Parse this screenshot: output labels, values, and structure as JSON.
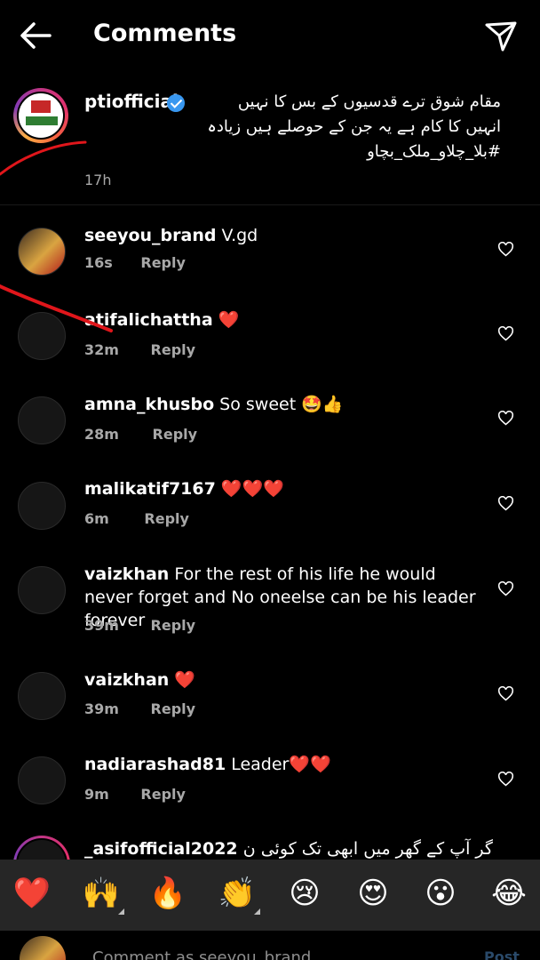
{
  "header": {
    "title": "Comments"
  },
  "caption": {
    "username": "ptiofficial",
    "lines": [
      "مقام شوق ترے قدسیوں کے بس کا نہیں",
      "انہیں کا کام ہے یہ جن کے حوصلے ہیں زیادہ",
      "#بلا_چلاو_ملک_بچاو"
    ],
    "time": "17h"
  },
  "comments": [
    {
      "username": "seeyou_brand",
      "text": "V.gd",
      "time": "16s",
      "reply": "Reply"
    },
    {
      "username": "atifalichattha",
      "text": "❤️",
      "time": "32m",
      "reply": "Reply"
    },
    {
      "username": "amna_khusbo",
      "text": "So sweet 🤩👍",
      "time": "28m",
      "reply": "Reply"
    },
    {
      "username": "malikatif7167",
      "text": "❤️❤️❤️",
      "time": "6m",
      "reply": "Reply"
    },
    {
      "username": "vaizkhan",
      "text": "For the rest of his life he would never forget and No oneelse can be his leader forever",
      "time": "39m",
      "reply": "Reply"
    },
    {
      "username": "vaizkhan",
      "text": "❤️",
      "time": "39m",
      "reply": "Reply"
    },
    {
      "username": "nadiarashad81",
      "text": "Leader❤️❤️",
      "time": "9m",
      "reply": "Reply"
    },
    {
      "username": "_asifofficial2022",
      "text": "اگر آپ کے گھر میں ابھی تک کوئی ن"
    }
  ],
  "emoji_bar": [
    "❤️",
    "🙌",
    "🔥",
    "👏",
    "😢",
    "😍",
    "😮",
    "😂"
  ],
  "input": {
    "placeholder": "Comment as seeyou_brand...",
    "post_label": "Post"
  },
  "colors": {
    "background": "#000000",
    "secondary_text": "#a8a8a8",
    "verified_blue": "#3897f0",
    "emoji_bar_bg": "#262626",
    "scribble_red": "#e0161b"
  }
}
